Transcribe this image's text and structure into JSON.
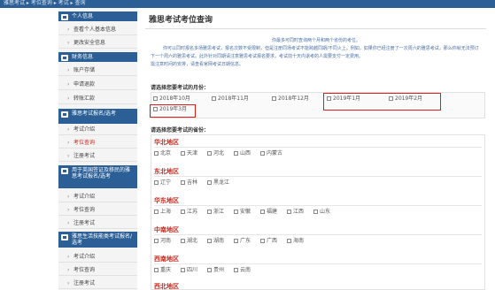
{
  "topbar": {
    "breadcrumb": "雅思考试 ▸ 考位查询 ▸ 考试 ▸ 查询"
  },
  "sidebar": {
    "sections": [
      {
        "title": "个人信息",
        "items": [
          "查看个人基本信息",
          "更改安全信息"
        ]
      },
      {
        "title": "财务信息",
        "items": [
          "账户存储",
          "申请退款",
          "转账汇款"
        ]
      },
      {
        "title": "雅思考试报名/选考",
        "items": [
          "考试介绍",
          "考位查询",
          "注册考试"
        ]
      },
      {
        "title": "用于英国签证及移民的雅思考试报名/选考",
        "items": [
          "考试介绍",
          "考位查询",
          "注册考试"
        ]
      },
      {
        "title": "雅思生活技能类考试报名/选考",
        "items": [
          "考试介绍",
          "考位查询",
          "注册考试"
        ]
      }
    ]
  },
  "main": {
    "title": "雅思考试考位查询",
    "notice": [
      "你最多可同时查询两个月和两个省份的考位。",
      "你可以同时报名多场雅思考试，报名次数不受限制，但是注册同场考试不能跨越同期/不同火上。例如，如果你已经注册了一次周六的雅思考试，那么你就无法预订下一个周六的雅思考试。此外针对同期请注意雅思考试报名要求，考试前十天内退考的人需要支付一定费用。",
      "需注意时间的安排，请查看官网考试日期信息。"
    ],
    "month_question": "请选择您要考试的月份：",
    "months": [
      "2018年10月",
      "2018年11月",
      "2018年12月",
      "2019年1月",
      "2019年2月",
      "2019年3月"
    ],
    "province_question": "请选择您要考试的省份：",
    "regions": [
      {
        "name": "华北地区",
        "provinces": [
          "北京",
          "天津",
          "河北",
          "山西",
          "内蒙古"
        ]
      },
      {
        "name": "东北地区",
        "provinces": [
          "辽宁",
          "吉林",
          "黑龙江"
        ]
      },
      {
        "name": "华东地区",
        "provinces": [
          "上海",
          "江苏",
          "浙江",
          "安徽",
          "福建",
          "江西",
          "山东"
        ]
      },
      {
        "name": "中南地区",
        "provinces": [
          "河南",
          "湖北",
          "湖南",
          "广东",
          "广西",
          "海南"
        ]
      },
      {
        "name": "西南地区",
        "provinces": [
          "重庆",
          "四川",
          "贵州",
          "云南"
        ]
      },
      {
        "name": "西北地区",
        "provinces": []
      }
    ]
  },
  "colors": {
    "accent": "#2b5f96",
    "highlight": "#e01b1b",
    "region_title": "#c8281e",
    "notice": "#4a6fa5"
  }
}
